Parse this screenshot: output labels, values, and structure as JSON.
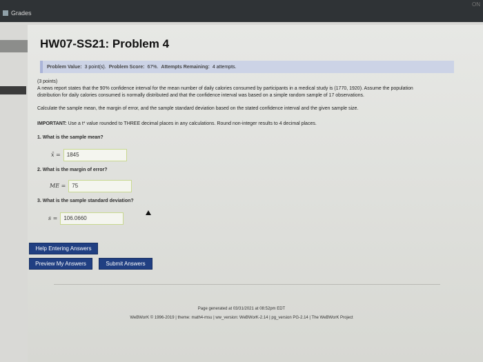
{
  "browser": {
    "tab_label": "Grades",
    "corner_text": "ON"
  },
  "page": {
    "title": "HW07-SS21: Problem 4"
  },
  "info": {
    "problem_value_label": "Problem Value:",
    "problem_value": "3 point(s).",
    "problem_score_label": "Problem Score:",
    "problem_score": "67%.",
    "attempts_label": "Attempts Remaining:",
    "attempts": "4 attempts."
  },
  "problem": {
    "points": "(3 points)",
    "paragraph_line1": "A news report states that the 90% confidence interval for the mean number of daily calories consumed by participants in a medical study is (1770, 1920). Assume the population",
    "paragraph_line2": "distribution for daily calories consumed is normally distributed and that the confidence interval was based on a simple random sample of 17 observations.",
    "instruction": "Calculate the sample mean, the margin of error, and the sample standard deviation based on the stated confidence interval and the given sample size.",
    "important_label": "IMPORTANT:",
    "important_text": "Use a t* value rounded to THREE decimal places in any calculations. Round non-integer results to 4 decimal places.",
    "q1": "1. What is the sample mean?",
    "q1_label": "x̄ =",
    "q1_value": "1845",
    "q2": "2. What is the margin of error?",
    "q2_label": "ME =",
    "q2_value": "75",
    "q3": "3. What is the sample standard deviation?",
    "q3_label": "s =",
    "q3_value": "106.0660"
  },
  "buttons": {
    "help": "Help Entering Answers",
    "preview": "Preview My Answers",
    "submit": "Submit Answers"
  },
  "footer": {
    "generated": "Page generated at 03/31/2021 at 08:52pm EDT",
    "credits": "WeBWorK © 1996-2019 | theme: math4-msu | ww_version: WeBWorK-2.14 | pg_version PG-2.14 | The WeBWorK Project"
  },
  "colors": {
    "button_bg": "#203f82",
    "info_bar_bg": "#ccd3e6",
    "answer_border": "#c8d88f"
  },
  "icons": {
    "tab_icon": "grades-icon",
    "cursor": "mouse-pointer-icon"
  }
}
